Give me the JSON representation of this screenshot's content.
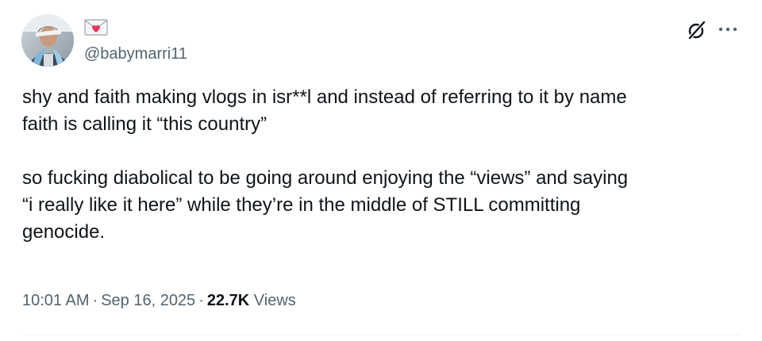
{
  "author": {
    "display_name_icon": "love-letter-envelope-icon",
    "handle": "@babymarri11",
    "avatar": "avatar-photo"
  },
  "tweet": {
    "paragraphs": [
      {
        "lines": [
          "shy and faith making vlogs in isr**l and instead of referring to it by name",
          "faith is calling it “this country”"
        ]
      },
      {
        "lines": [
          "so fucking diabolical to be going around enjoying the “views” and saying",
          "“i really like it here” while they’re in the middle of STILL committing",
          "genocide."
        ]
      }
    ]
  },
  "meta": {
    "time": "10:01 AM",
    "date": "Sep 16, 2025",
    "separator": "·",
    "views_count": "22.7K",
    "views_label": "Views"
  },
  "actions": {
    "grok_icon": "grok-slash-icon",
    "more_icon": "more-options-icon"
  },
  "colors": {
    "text": "#0f1419",
    "secondary": "#536471",
    "divider": "#eff3f4",
    "heart": "#e8365d"
  }
}
